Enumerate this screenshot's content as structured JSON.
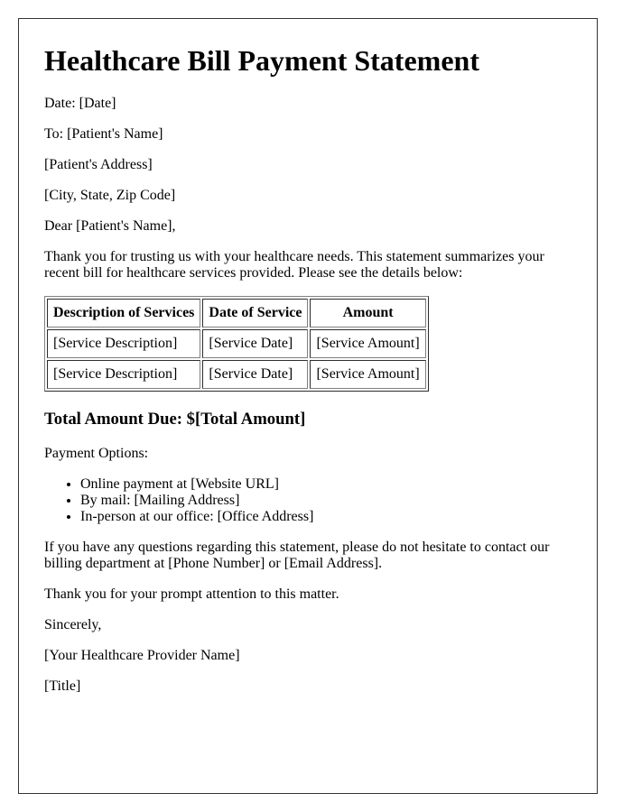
{
  "title": "Healthcare Bill Payment Statement",
  "header": {
    "date": "Date: [Date]",
    "to": "To: [Patient's Name]",
    "address": "[Patient's Address]",
    "city": "[City, State, Zip Code]"
  },
  "salutation": "Dear [Patient's Name],",
  "intro": "Thank you for trusting us with your healthcare needs. This statement summarizes your recent bill for healthcare services provided. Please see the details below:",
  "table": {
    "headers": [
      "Description of Services",
      "Date of Service",
      "Amount"
    ],
    "rows": [
      [
        "[Service Description]",
        "[Service Date]",
        "[Service Amount]"
      ],
      [
        "[Service Description]",
        "[Service Date]",
        "[Service Amount]"
      ]
    ]
  },
  "total": "Total Amount Due: $[Total Amount]",
  "payment": {
    "label": "Payment Options:",
    "options": [
      "Online payment at [Website URL]",
      "By mail: [Mailing Address]",
      "In-person at our office: [Office Address]"
    ]
  },
  "questions": "If you have any questions regarding this statement, please do not hesitate to contact our billing department at [Phone Number] or [Email Address].",
  "thanks": "Thank you for your prompt attention to this matter.",
  "closing": "Sincerely,",
  "signature": {
    "provider": "[Your Healthcare Provider Name]",
    "title": "[Title]"
  }
}
